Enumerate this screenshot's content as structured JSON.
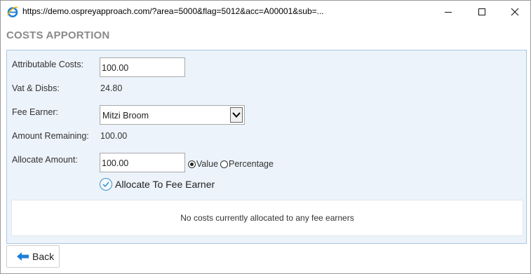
{
  "window": {
    "url": "https://demo.ospreyapproach.com/?area=5000&flag=5012&acc=A00001&sub=...",
    "controls": [
      "minimize-icon",
      "maximize-icon",
      "close-icon"
    ]
  },
  "page": {
    "title": "COSTS APPORTION"
  },
  "form": {
    "attributable_costs_label": "Attributable Costs:",
    "attributable_costs_value": "100.00",
    "vat_disbs_label": "Vat & Disbs:",
    "vat_disbs_value": "24.80",
    "fee_earner_label": "Fee Earner:",
    "fee_earner_value": "Mitzi Broom",
    "amount_remaining_label": "Amount Remaining:",
    "amount_remaining_value": "100.00",
    "allocate_amount_label": "Allocate Amount:",
    "allocate_amount_value": "100.00",
    "allocation_type_options": [
      "Value",
      "Percentage"
    ],
    "allocation_type_selected": "Value",
    "allocate_button_label": "Allocate To Fee Earner"
  },
  "allocations": {
    "empty_message": "No costs currently allocated to any fee earners"
  },
  "footer": {
    "back_label": "Back"
  },
  "colors": {
    "accent": "#3a8fd0",
    "panel_bg": "#ecf3fa",
    "panel_border": "#aac8e0",
    "heading": "#8a8a8a"
  }
}
